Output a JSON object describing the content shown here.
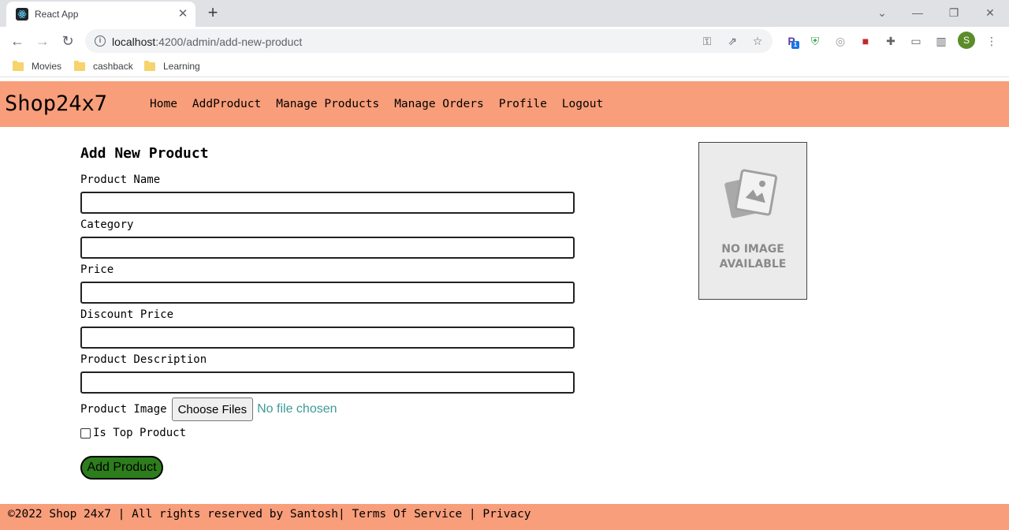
{
  "browser": {
    "tab_title": "React App",
    "url_host": "localhost",
    "url_rest": ":4200/admin/add-new-product",
    "profile_initial": "S",
    "extension_badge": "1",
    "bookmarks": [
      "Movies",
      "cashback",
      "Learning"
    ]
  },
  "app": {
    "brand": "Shop24x7",
    "menu": [
      "Home",
      "AddProduct",
      "Manage Products",
      "Manage Orders",
      "Profile",
      "Logout"
    ],
    "colors": {
      "nav_bg": "#f89e7b",
      "submit_bg": "#2d7d1c"
    }
  },
  "form": {
    "title": "Add New Product",
    "fields": [
      {
        "label": "Product Name",
        "value": ""
      },
      {
        "label": "Category",
        "value": ""
      },
      {
        "label": "Price",
        "value": ""
      },
      {
        "label": "Discount Price",
        "value": ""
      },
      {
        "label": "Product Description",
        "value": ""
      }
    ],
    "image_label": "Product Image",
    "file_button": "Choose Files",
    "file_status": "No file chosen",
    "checkbox_label": "Is Top Product",
    "checkbox_checked": false,
    "submit_label": "Add Product"
  },
  "preview": {
    "line1": "NO IMAGE",
    "line2": "AVAILABLE"
  },
  "footer": {
    "copyright": "©2022 Shop 24x7 | All rights reserved by Santosh|",
    "terms": "Terms Of Service",
    "separator": "|",
    "privacy": "Privacy"
  }
}
